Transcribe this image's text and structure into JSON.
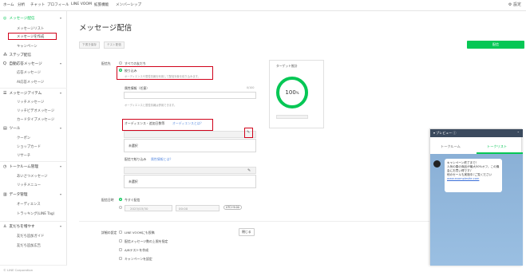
{
  "topnav": {
    "items": [
      "ホーム",
      "分析",
      "チャット",
      "プロフィール",
      "LINE VOOM",
      "拡張機能",
      "メンバーシップ"
    ],
    "gear": "⚙ 設定"
  },
  "sidebar": {
    "sections": [
      {
        "label": "メッセージ配信",
        "icon": "◎",
        "items": [
          "メッセージリスト",
          "メッセージを作成",
          "キャンペーン"
        ]
      },
      {
        "label": "ステップ配信",
        "icon": "⁂",
        "items": []
      },
      {
        "label": "自動応答メッセージ",
        "icon": "Q",
        "items": [
          "応答メッセージ",
          "AI応答メッセージ"
        ]
      },
      {
        "label": "メッセージアイテム",
        "icon": "☰",
        "items": [
          "リッチメッセージ",
          "リッチビデオメッセージ",
          "カードタイプメッセージ"
        ]
      },
      {
        "label": "ツール",
        "icon": "▤",
        "items": [
          "クーポン",
          "ショップカード",
          "リサーチ"
        ]
      },
      {
        "label": "トークルーム管理",
        "icon": "◷",
        "items": [
          "あいさつメッセージ",
          "リッチメニュー"
        ]
      },
      {
        "label": "データ管理",
        "icon": "▥",
        "items": [
          "オーディエンス",
          "トラッキング(LINE Tag)"
        ]
      },
      {
        "label": "友だちを増やす",
        "icon": "♙",
        "items": [
          "友だち追加ガイド",
          "友だち追加広告"
        ]
      }
    ],
    "bottom": "© LINE Corporation"
  },
  "main": {
    "title": "メッセージ配信",
    "toolbar": {
      "btn1": "下書き保存",
      "btn2": "テスト配信",
      "save": "配信"
    },
    "recipients_label": "配信先",
    "opt_all": "すべての友だち",
    "opt_filter": "絞り込み",
    "filter_note": "オーディエンスや属性情報を利用して配信対象を絞り込みます。",
    "attr_label": "属性情報（任意）",
    "counter": "0/100",
    "attr_note": "オーディエンスと属性情報は併用できます。",
    "audience_label": "オーディエンス・追加日数等",
    "audience_link": "オーディエンスとは？",
    "unset1": "未選択",
    "exclude_label": "配信で絞り込み",
    "exclude_link": "属性情報とは？",
    "unset2": "未選択",
    "time_label": "配信日時",
    "time_now": "今すぐ配信",
    "date_placeholder": "2023/03/30",
    "time_placeholder": "00:00",
    "tz": "UTC+9:00",
    "advanced_label": "詳細の設定",
    "adv_opt1": "LINE VOOMにも投稿",
    "adv_opt2": "配信メッセージ数の上限を指定",
    "adv_opt3": "A/Bテストを作成",
    "adv_opt4": "キャンペーンを設定",
    "close_label": "閉じる"
  },
  "target": {
    "title": "ターゲット推計",
    "value": "100",
    "unit": "%"
  },
  "preview": {
    "title": "プレビュー",
    "tab1": "トークルーム",
    "tab2": "トークリスト",
    "lines": [
      "キャンペーン終了まで！",
      "人気の春の商品が最大50%オフ。この機",
      "会にお買い得です♪",
      "他のセールも実施中♪ご覧ください",
      "www.examplesite.com"
    ]
  }
}
